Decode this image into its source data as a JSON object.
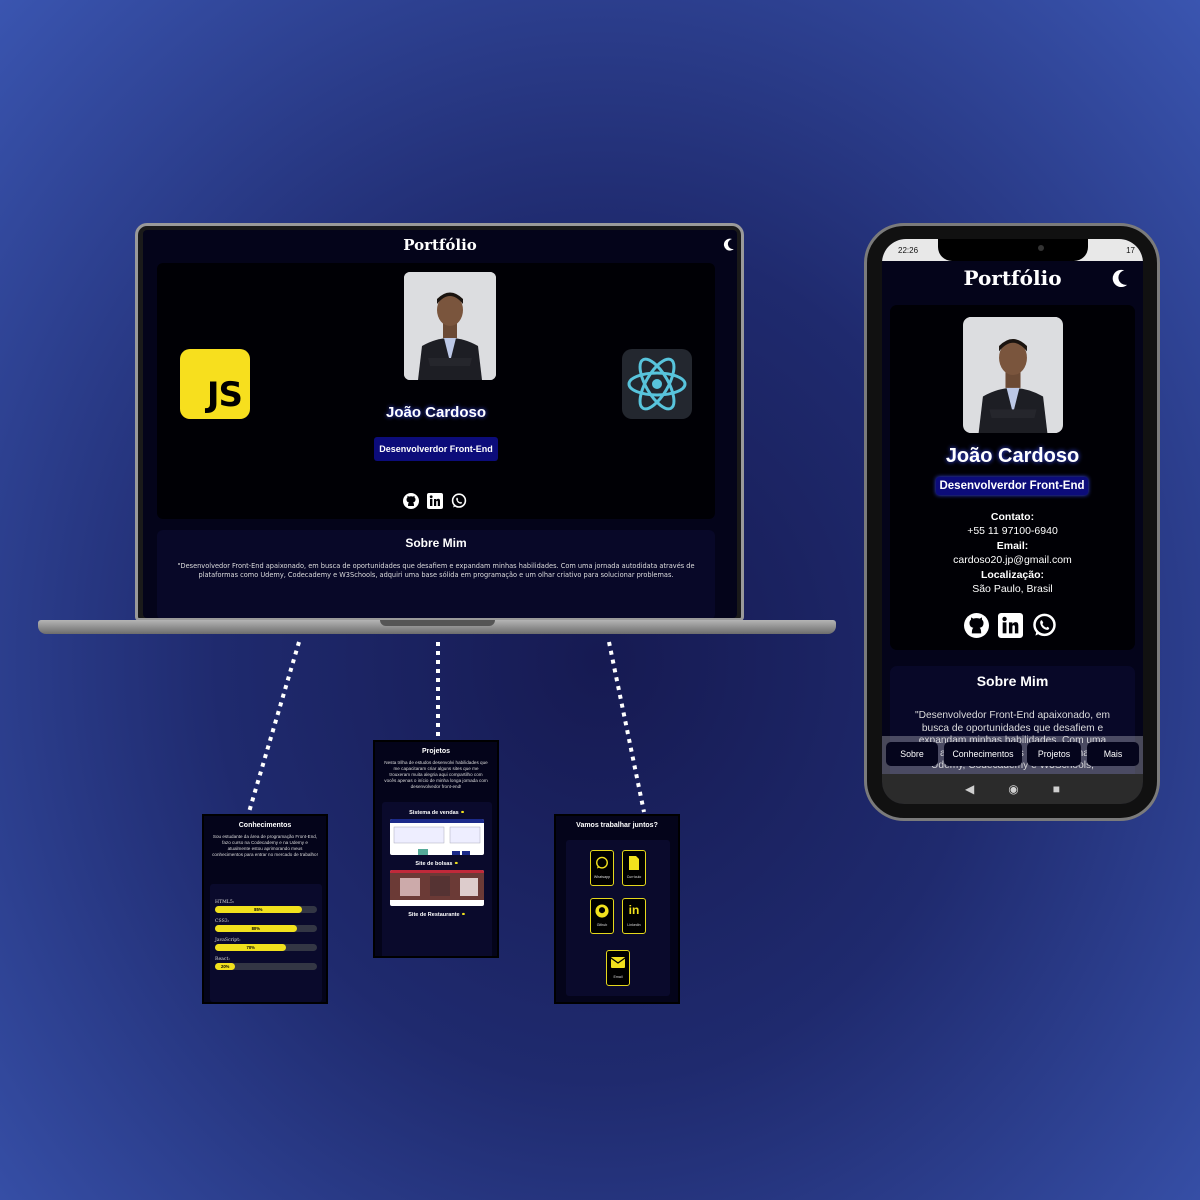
{
  "laptop": {
    "title": "Portfólio",
    "name": "João Cardoso",
    "role": "Desenvolverdor Front-End",
    "about_title": "Sobre Mim",
    "about_text": "\"Desenvolvedor Front-End apaixonado, em busca de oportunidades que desafiem e expandam minhas habilidades. Com uma jornada autodidata através de plataformas como Udemy, Codecademy e W3Schools, adquiri uma base sólida em programação e um olhar criativo para solucionar problemas.",
    "js_logo_text": "JS"
  },
  "knowledge": {
    "title": "Conhecimentos",
    "text": "Sou estudante da área de programação Front-End, fazo curso na Codecademy e na Udemy e atualmente estou aprimorando meus conhecimentos para entrar no mercado de trabalho!",
    "skills": [
      {
        "label": "HTML5:",
        "percent": 85,
        "text": "85%"
      },
      {
        "label": "CSS3:",
        "percent": 80,
        "text": "80%"
      },
      {
        "label": "JavaScript:",
        "percent": 70,
        "text": "70%"
      },
      {
        "label": "React:",
        "percent": 20,
        "text": "20%"
      }
    ]
  },
  "projects": {
    "title": "Projetos",
    "text": "Nesta trilha de estudos desenvolvi habilidades que me capacitaram criar alguns sites que me trouxeram muita alegria aqui compartilho com vocês apenas o início de minha longa jornada com desenvolvedor front-end!",
    "items": [
      "Sistema de vendas",
      "Site de bolsas",
      "Site de Restaurante"
    ]
  },
  "contact": {
    "title": "Vamos trabalhar juntos?",
    "buttons": [
      "Whatsapp",
      "Currículo",
      "Github",
      "Linkedin",
      "Email"
    ]
  },
  "phone": {
    "status_time": "22:26",
    "status_battery": "17",
    "title": "Portfólio",
    "name": "João Cardoso",
    "role": "Desenvolverdor Front-End",
    "contact_label": "Contato:",
    "phone_number": "+55 11 97100-6940",
    "email_label": "Email:",
    "email": "cardoso20.jp@gmail.com",
    "location_label": "Localização:",
    "location": "São Paulo, Brasil",
    "about_title": "Sobre Mim",
    "about_text": "\"Desenvolvedor Front-End apaixonado, em busca de oportunidades que desafiem e expandam minhas habilidades. Com uma jornada autodidata através de plataformas como Udemy, Codecademy e W3Schools,",
    "nav": [
      "Sobre",
      "Conhecimentos",
      "Projetos",
      "Mais"
    ],
    "sys_nav": [
      "◀",
      "◉",
      "■"
    ]
  },
  "colors": {
    "accent_yellow": "#f1e11d",
    "badge_blue": "#0c0c7a",
    "panel_dark": "#04041a"
  },
  "icons": [
    "moon-icon",
    "github-icon",
    "linkedin-icon",
    "whatsapp-icon",
    "javascript-logo",
    "react-logo",
    "file-icon",
    "email-icon",
    "link-icon"
  ]
}
